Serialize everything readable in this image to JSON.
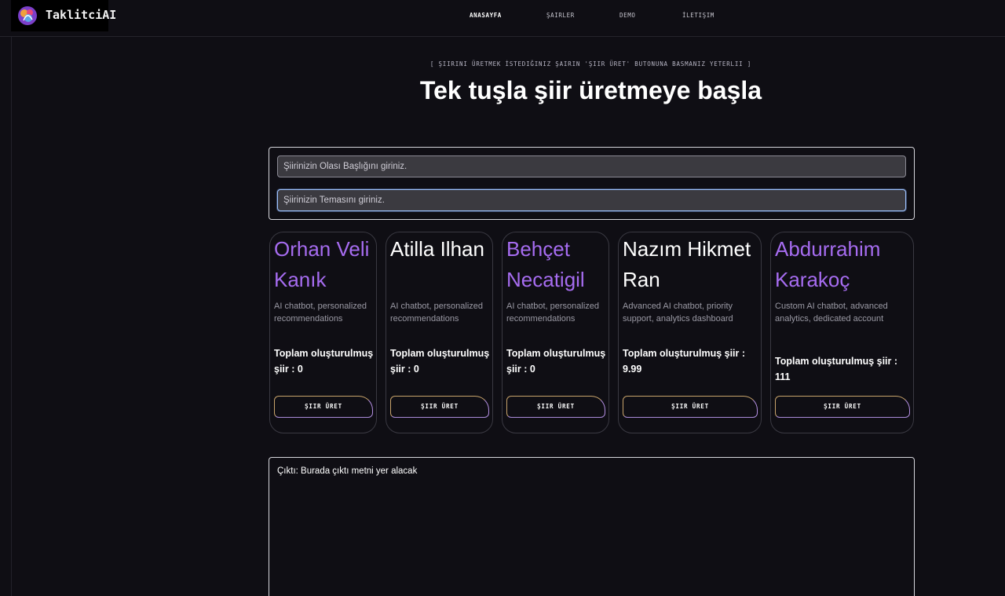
{
  "brand": {
    "name": "TaklitciAI",
    "logo_icon": "brain-icon"
  },
  "nav": {
    "items": [
      {
        "label": "ANASAYFA",
        "active": true
      },
      {
        "label": "ŞAIRLER",
        "active": false
      },
      {
        "label": "DEMO",
        "active": false
      },
      {
        "label": "İLETIŞIM",
        "active": false
      }
    ]
  },
  "hero": {
    "kicker": "[ ŞIIRINI ÜRETMEK İSTEDIĞINIZ ŞAIRIN 'ŞIIR ÜRET' BUTONUNA BASMANIZ YETERLII ]",
    "headline": "Tek tuşla şiir üretmeye başla"
  },
  "form": {
    "title_placeholder": "Şiirinizin Olası Başlığını giriniz.",
    "theme_placeholder": "Şiirinizin Temasını giriniz."
  },
  "poets": [
    {
      "name": "Orhan Veli Kanık",
      "description": "AI chatbot, personalized recommendations",
      "total": "Toplam oluşturulmuş şiir : 0",
      "button": "ŞIIR ÜRET"
    },
    {
      "name": "Atilla Ilhan",
      "description": "AI chatbot, personalized recommendations",
      "total": "Toplam oluşturulmuş şiir : 0",
      "button": "ŞIIR ÜRET"
    },
    {
      "name": "Behçet Necatigil",
      "description": "AI chatbot, personalized recommendations",
      "total": "Toplam oluşturulmuş şiir : 0",
      "button": "ŞIIR ÜRET"
    },
    {
      "name": "Nazım Hikmet Ran",
      "description": "Advanced AI chatbot, priority support, analytics dashboard",
      "total": "Toplam oluşturulmuş şiir : 9.99",
      "button": "ŞIIR ÜRET"
    },
    {
      "name": "Abdurrahim Karakoç",
      "description": "Custom AI chatbot, advanced analytics, dedicated account",
      "total": "Toplam oluşturulmuş şiir : 111",
      "button": "ŞIIR ÜRET"
    }
  ],
  "output": {
    "text": "Çıktı: Burada çıktı metni yer alacak"
  },
  "colors": {
    "background": "#0f0e14",
    "accent_purple": "#a66cf0",
    "input_bg": "#3b3a40",
    "button_border_gold": "#c9a46b",
    "button_border_violet": "#b28de0"
  }
}
